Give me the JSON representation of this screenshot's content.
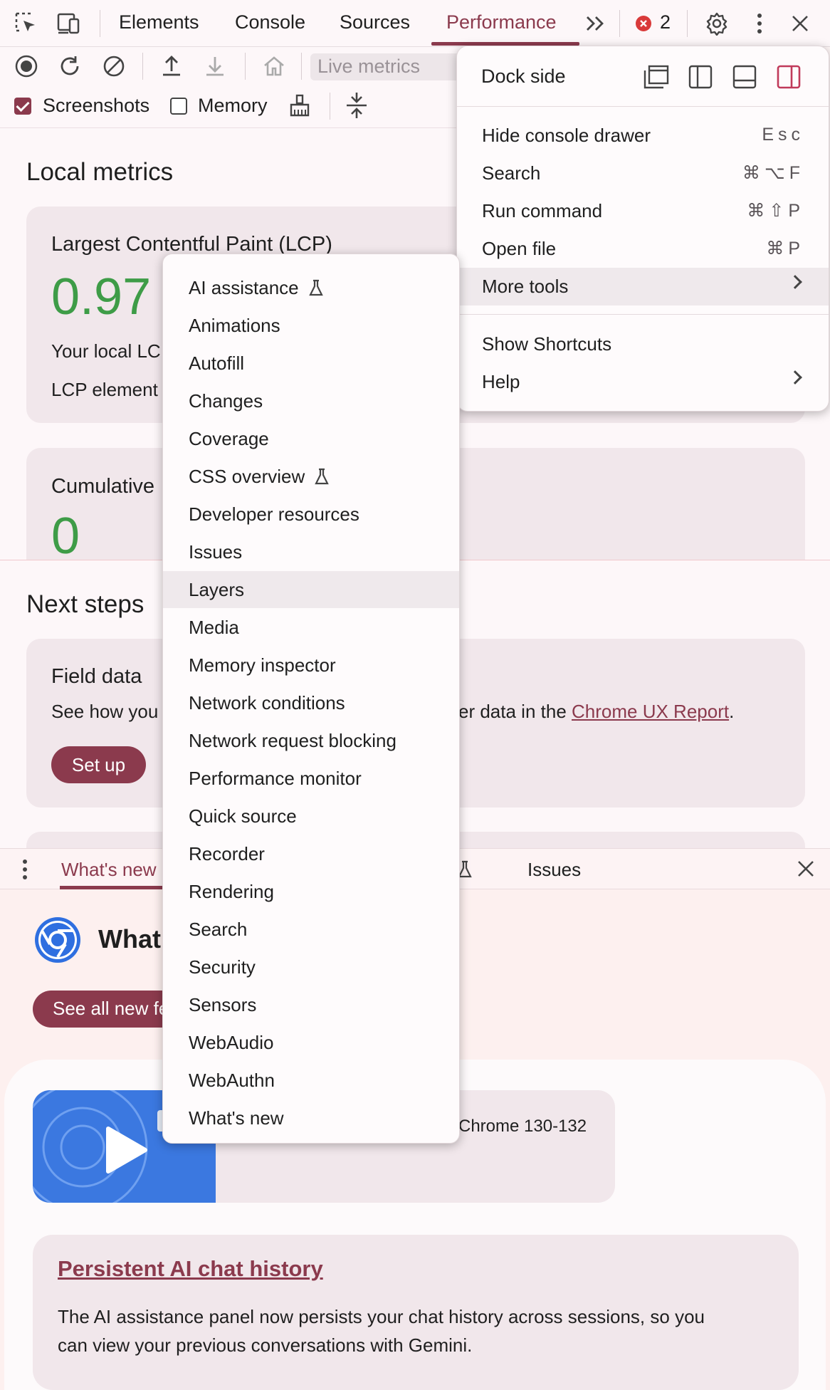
{
  "tabs": {
    "elements": "Elements",
    "console": "Console",
    "sources": "Sources",
    "performance": "Performance",
    "error_count": "2"
  },
  "toolbar": {
    "live_metrics": "Live metrics",
    "screenshots_label": "Screenshots",
    "screenshots_checked": true,
    "memory_label": "Memory",
    "memory_checked": false
  },
  "main": {
    "local_metrics_title": "Local metrics",
    "lcp": {
      "title": "Largest Contentful Paint (LCP)",
      "value": "0.97",
      "local_text": "Your local LC",
      "element_text": "LCP element"
    },
    "cls": {
      "title": "Cumulative",
      "value": "0"
    },
    "next_steps_title": "Next steps",
    "field_data": {
      "title": "Field data",
      "text_left": "See how you",
      "text_right": "er data in the ",
      "link": "Chrome UX Report",
      "text_end": ".",
      "setup_button": "Set up"
    }
  },
  "drawer": {
    "whats_new_tab": "What's new",
    "issues_tab": "Issues",
    "header": "What",
    "see_all_button": "See all new features",
    "video_caption": "Chrome 130-132",
    "ai_article": {
      "title": "Persistent AI chat history",
      "body_line1": "The AI assistance panel now persists your chat history across sessions, so you",
      "body_line2": "can view your previous conversations with Gemini."
    }
  },
  "main_menu": {
    "dock_side": "Dock side",
    "items": [
      {
        "label": "Hide console drawer",
        "shortcut": "Esc"
      },
      {
        "label": "Search",
        "shortcut": "⌘⌥F"
      },
      {
        "label": "Run command",
        "shortcut": "⌘⇧P"
      },
      {
        "label": "Open file",
        "shortcut": "⌘P"
      },
      {
        "label": "More tools",
        "shortcut": ""
      },
      {
        "label": "Show Shortcuts",
        "shortcut": ""
      },
      {
        "label": "Help",
        "shortcut": ""
      }
    ]
  },
  "more_tools_menu": {
    "highlighted": "Layers",
    "items": [
      {
        "label": "AI assistance",
        "experimental": true
      },
      {
        "label": "Animations"
      },
      {
        "label": "Autofill"
      },
      {
        "label": "Changes"
      },
      {
        "label": "Coverage"
      },
      {
        "label": "CSS overview",
        "experimental": true
      },
      {
        "label": "Developer resources"
      },
      {
        "label": "Issues"
      },
      {
        "label": "Layers"
      },
      {
        "label": "Media"
      },
      {
        "label": "Memory inspector"
      },
      {
        "label": "Network conditions"
      },
      {
        "label": "Network request blocking"
      },
      {
        "label": "Performance monitor"
      },
      {
        "label": "Quick source"
      },
      {
        "label": "Recorder"
      },
      {
        "label": "Rendering"
      },
      {
        "label": "Search"
      },
      {
        "label": "Security"
      },
      {
        "label": "Sensors"
      },
      {
        "label": "WebAudio"
      },
      {
        "label": "WebAuthn"
      },
      {
        "label": "What's new"
      }
    ]
  },
  "colors": {
    "accent": "#8b3a4d",
    "good_metric": "#3e9c47",
    "error_badge": "#d93a3a",
    "chrome_blue": "#3b78e0"
  }
}
